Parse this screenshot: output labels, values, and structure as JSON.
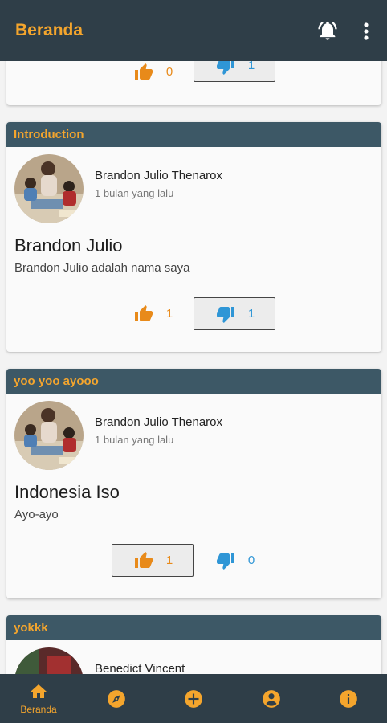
{
  "appbar": {
    "title": "Beranda"
  },
  "posts": [
    {
      "category": "",
      "author": "",
      "time": "",
      "title": "",
      "body": "",
      "likes": "0",
      "dislikes": "1",
      "highlighted": "dislike"
    },
    {
      "category": "Introduction",
      "author": "Brandon Julio Thenarox",
      "time": "1 bulan yang lalu",
      "title": "Brandon Julio",
      "body": "Brandon Julio adalah nama saya",
      "likes": "1",
      "dislikes": "1",
      "highlighted": "dislike"
    },
    {
      "category": "yoo yoo ayooo",
      "author": "Brandon Julio Thenarox",
      "time": "1 bulan yang lalu",
      "title": "Indonesia Iso",
      "body": "Ayo-ayo",
      "likes": "1",
      "dislikes": "0",
      "highlighted": "like"
    },
    {
      "category": "yokkk",
      "author": "Benedict Vincent",
      "time": "",
      "title": "",
      "body": "",
      "likes": "",
      "dislikes": "",
      "highlighted": ""
    }
  ],
  "bottom_nav": [
    {
      "icon": "home-icon",
      "label": "Beranda",
      "active": true
    },
    {
      "icon": "compass-icon",
      "label": "",
      "active": false
    },
    {
      "icon": "add-circle-icon",
      "label": "",
      "active": false
    },
    {
      "icon": "account-icon",
      "label": "",
      "active": false
    },
    {
      "icon": "info-icon",
      "label": "",
      "active": false
    }
  ],
  "colors": {
    "appbar": "#2f3e48",
    "accent": "#f4a52d",
    "card_header": "#3d5866",
    "like": "#e88a1a",
    "dislike": "#2f96d6"
  }
}
